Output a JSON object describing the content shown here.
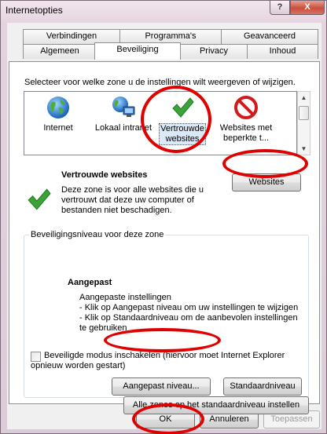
{
  "window": {
    "title": "Internetopties",
    "help_label": "?",
    "close_label": "X"
  },
  "tabs": {
    "row1": [
      "Verbindingen",
      "Programma's",
      "Geavanceerd"
    ],
    "row2": [
      "Algemeen",
      "Beveiliging",
      "Privacy",
      "Inhoud"
    ],
    "active": "Beveiliging"
  },
  "security": {
    "zone_prompt": "Selecteer voor welke zone u de instellingen wilt weergeven of wijzigen.",
    "zones": [
      {
        "line1": "Internet",
        "line2": "",
        "icon": "globe-icon"
      },
      {
        "line1": "Lokaal intranet",
        "line2": "",
        "icon": "intranet-icon"
      },
      {
        "line1": "Vertrouwde",
        "line2": "websites",
        "icon": "checkmark-icon"
      },
      {
        "line1": "Websites met",
        "line2": "beperkte t...",
        "icon": "restricted-icon"
      }
    ],
    "selected_zone_title": "Vertrouwde websites",
    "zone_description": [
      "Deze zone is voor alle websites die u",
      "vertrouwt dat deze uw computer of",
      "bestanden niet beschadigen."
    ],
    "websites_button": "Websites",
    "level_group_title": "Beveiligingsniveau voor deze zone",
    "level_name": "Aangepast",
    "level_description": [
      "Aangepaste instellingen",
      "- Klik op Aangepast niveau om uw instellingen te wijzigen",
      "- Klik op Standaardniveau om de aanbevolen instellingen",
      "te gebruiken"
    ],
    "protected_mode_line1": "Beveiligde modus inschakelen (hiervoor moet Internet Explorer",
    "protected_mode_line2": "opnieuw worden gestart)",
    "protected_mode_checked": false,
    "custom_level_button": "Aangepast niveau...",
    "default_level_button": "Standaardniveau",
    "reset_all_button": "Alle zones op het standaardniveau instellen"
  },
  "footer": {
    "ok": "OK",
    "cancel": "Annuleren",
    "apply": "Toepassen"
  },
  "colors": {
    "annotation_circle": "#e00000",
    "checkmark": "#3aa43a",
    "restricted": "#d11a1a"
  }
}
